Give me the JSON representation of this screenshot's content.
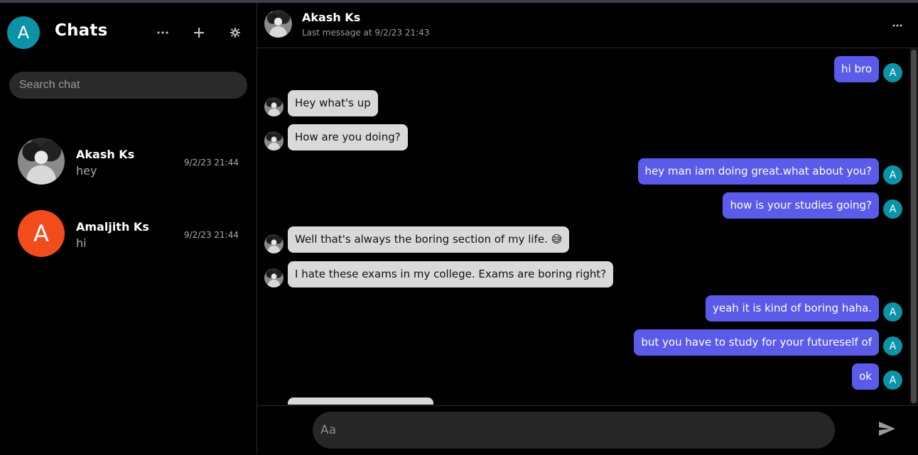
{
  "sidebar": {
    "me_avatar_letter": "A",
    "title": "Chats",
    "icons": [
      "more-icon",
      "plus-icon",
      "settings-icon"
    ],
    "search_placeholder": "Search chat",
    "chats": [
      {
        "name": "Akash Ks",
        "last_message": "hey",
        "time": "9/2/23 21:44",
        "avatar": "photo"
      },
      {
        "name": "Amaljith Ks",
        "last_message": "hi",
        "time": "9/2/23 21:44",
        "avatar_letter": "A",
        "avatar_color": "#f24c1d"
      }
    ]
  },
  "chat": {
    "name": "Akash Ks",
    "subtitle": "Last message at 9/2/23 21:43",
    "my_avatar_letter": "A",
    "messages": [
      {
        "dir": "out",
        "text": "hi bro"
      },
      {
        "dir": "in",
        "text": "Hey what's up"
      },
      {
        "dir": "in",
        "text": "How are you doing?"
      },
      {
        "dir": "out",
        "text": "hey man iam doing great.what about you?"
      },
      {
        "dir": "out",
        "text": "how is your studies going?"
      },
      {
        "dir": "in",
        "text": "Well that's always the boring section of my life. 😅"
      },
      {
        "dir": "in",
        "text": "I hate these exams in my college. Exams are boring right?"
      },
      {
        "dir": "out",
        "text": "yeah it is kind of boring haha."
      },
      {
        "dir": "out",
        "text": "but you have to study for your futureself of"
      },
      {
        "dir": "out",
        "text": "ok"
      }
    ]
  },
  "composer": {
    "placeholder": "Aa",
    "send_icon": "send-icon"
  },
  "colors": {
    "outgoing": "#5b5bea",
    "incoming": "#d9d9d9",
    "my_avatar": "#0d93a8"
  }
}
